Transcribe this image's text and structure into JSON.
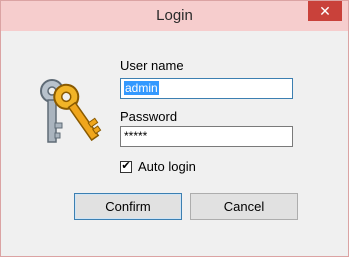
{
  "window": {
    "title": "Login",
    "close_glyph": "✕"
  },
  "form": {
    "username_label": "User name",
    "username_value": "admin",
    "password_label": "Password",
    "password_value": "*****",
    "auto_login_label": "Auto login",
    "auto_login_checked": true,
    "check_glyph": "✔"
  },
  "buttons": {
    "confirm": "Confirm",
    "cancel": "Cancel"
  },
  "icon": {
    "name": "keys-icon"
  },
  "colors": {
    "title_bar": "#f6cdcd",
    "close": "#c9413a",
    "selection": "#3399ff",
    "focus_border": "#3c7fb1"
  }
}
